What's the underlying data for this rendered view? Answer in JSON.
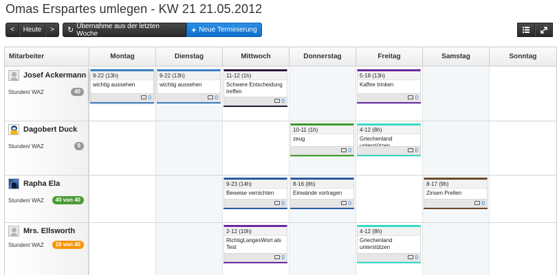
{
  "page": {
    "title": "Omas Erspartes umlegen - KW 21 21.05.2012"
  },
  "toolbar": {
    "prev": "<",
    "today": "Heute",
    "next": ">",
    "takeover": "Übernahme aus der letzten Woche",
    "takeover_icon": "refresh-icon",
    "new": "Neue Terminierung",
    "new_icon": "plus-icon",
    "view_list_icon": "list-icon",
    "fullscreen_icon": "expand-icon"
  },
  "calendar": {
    "columns": [
      "Mitarbeiter",
      "Montag",
      "Dienstag",
      "Mittwoch",
      "Donnerstag",
      "Freitag",
      "Samstag",
      "Sonntag"
    ],
    "employees": [
      {
        "name": "Josef Ackermann",
        "sub": "Stunden/ WAZ",
        "badge": "40",
        "badge_color": "gray",
        "avatar": "person-icon",
        "events": [
          {
            "day": 1,
            "time": "9-22 (13h)",
            "text": "wichtig aussehen",
            "comments": "0",
            "color": "#3c7fc0"
          },
          {
            "day": 2,
            "time": "9-22 (13h)",
            "text": "wichtig aussehen",
            "comments": "0",
            "color": "#3c7fc0"
          },
          {
            "day": 3,
            "time": "11-12 (1h)",
            "text": "Schwere Entscheidung treffen",
            "comments": "0",
            "color": "#2a1a3a"
          },
          {
            "day": 5,
            "time": "5-18 (13h)",
            "text": "Kaffee trinken",
            "comments": "0",
            "color": "#6a2aa0"
          }
        ]
      },
      {
        "name": "Dagobert Duck",
        "sub": "Stunden/ WAZ",
        "badge": "9",
        "badge_color": "gray",
        "avatar": "duck-avatar",
        "events": [
          {
            "day": 4,
            "time": "10-11 (1h)",
            "text": "zeug",
            "comments": "0",
            "color": "#3a9a2a"
          },
          {
            "day": 5,
            "time": "4-12 (8h)",
            "text": "Griechenland unterstützen",
            "comments": "0",
            "color": "#36d8c8"
          }
        ]
      },
      {
        "name": "Rapha Ela",
        "sub": "Stunden/ WAZ",
        "badge": "40 von 40",
        "badge_color": "green",
        "avatar": "photo-avatar",
        "events": [
          {
            "day": 3,
            "time": "9-23 (14h)",
            "text": "Beweise vernichten",
            "comments": "0",
            "color": "#2a5aa0"
          },
          {
            "day": 4,
            "time": "8-16 (8h)",
            "text": "Einwände vortragen",
            "comments": "0",
            "color": "#2a5aa0"
          },
          {
            "day": 6,
            "time": "8-17 (9h)",
            "text": "Zinsen Prellen",
            "comments": "0",
            "color": "#6a4a2a"
          }
        ]
      },
      {
        "name": "Mrs. Ellsworth",
        "sub": "Stunden/ WAZ",
        "badge": "18 von 40",
        "badge_color": "orange",
        "avatar": "person-icon",
        "events": [
          {
            "day": 3,
            "time": "2-12 (10h)",
            "text": "RichtigLangesWort als Test",
            "comments": "0",
            "color": "#6a2aa0"
          },
          {
            "day": 5,
            "time": "4-12 (8h)",
            "text": "Griechenland unterstützen",
            "comments": "0",
            "color": "#36d8c8"
          }
        ]
      }
    ]
  }
}
